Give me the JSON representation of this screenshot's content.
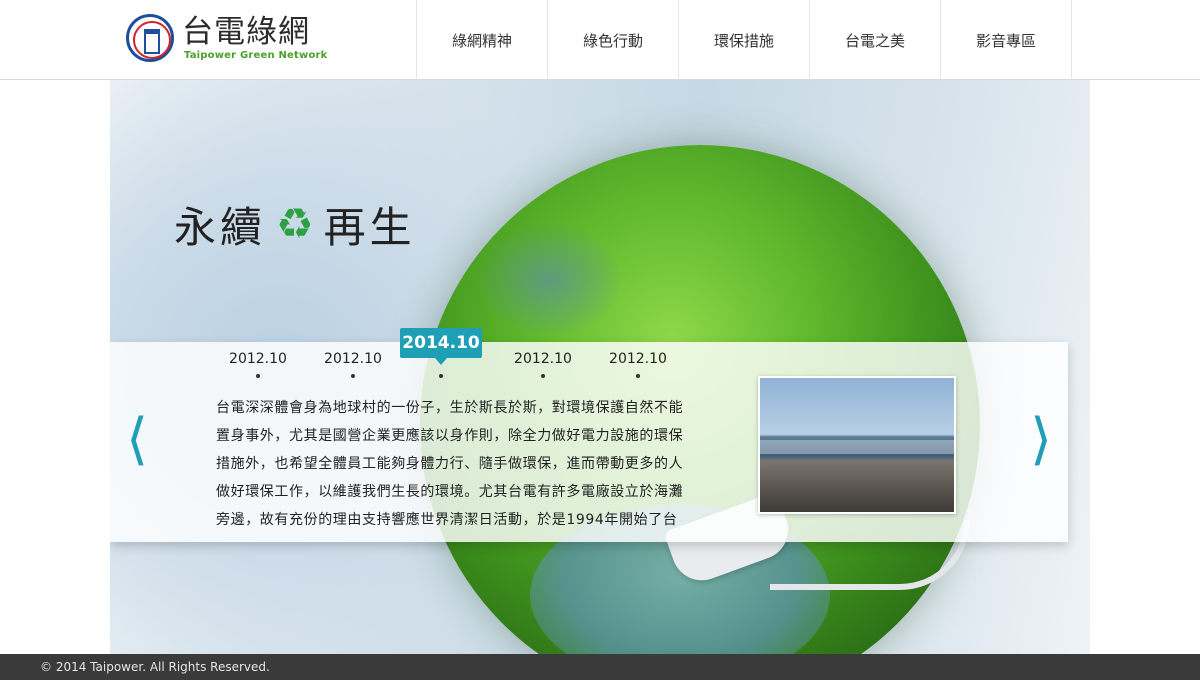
{
  "header": {
    "logo_title": "台電綠網",
    "logo_subtitle": "Taipower Green Network",
    "nav": [
      {
        "label": "綠網精神"
      },
      {
        "label": "綠色行動"
      },
      {
        "label": "環保措施"
      },
      {
        "label": "台電之美"
      },
      {
        "label": "影音專區"
      }
    ]
  },
  "hero": {
    "tagline_left": "永續",
    "tagline_icon": "recycle-icon",
    "tagline_right": "再生",
    "timeline": {
      "items": [
        "2012.10",
        "2012.10",
        "2014.10",
        "2012.10",
        "2012.10"
      ],
      "active_index": 2
    },
    "body_lines": [
      "台電深深體會身為地球村的一份子，生於斯長於斯，對環境保護自然不能",
      "置身事外，尤其是國營企業更應該以身作則，除全力做好電力設施的環保",
      "措施外，也希望全體員工能夠身體力行、隨手做環保，進而帶動更多的人",
      "做好環保工作，以維護我們生長的環境。尤其台電有許多電廠設立於海灘",
      "旁邊，故有充份的理由支持響應世界清潔日活動，於是1994年開始了台"
    ],
    "arrows": {
      "left": "prev-arrow-icon",
      "right": "next-arrow-icon"
    },
    "accent_color": "#1f9fb5"
  },
  "footer": {
    "copyright": "© 2014 Taipower. All Rights Reserved."
  }
}
